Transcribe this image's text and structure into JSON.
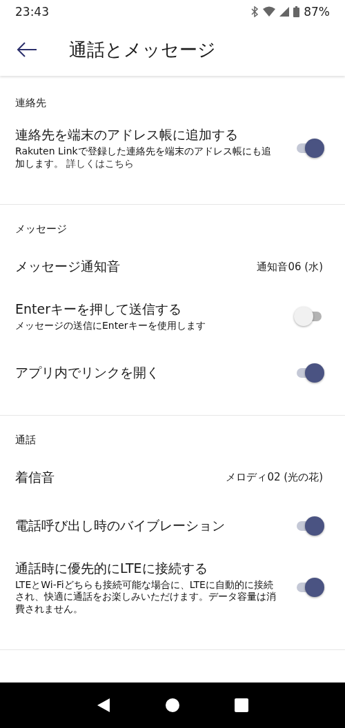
{
  "status_bar": {
    "time": "23:43",
    "battery": "87%"
  },
  "header": {
    "title": "通話とメッセージ"
  },
  "sections": [
    {
      "title": "連絡先",
      "items": [
        {
          "kind": "toggle",
          "label": "連絡先を端末のアドレス帳に追加する",
          "description": "Rakuten Linkで登録した連絡先を端末のアドレス帳にも追加します。",
          "link": "詳しくはこちら",
          "on": true
        }
      ]
    },
    {
      "title": "メッセージ",
      "items": [
        {
          "kind": "value",
          "label": "メッセージ通知音",
          "value": "通知音06 (水)"
        },
        {
          "kind": "toggle",
          "label": "Enterキーを押して送信する",
          "description": "メッセージの送信にEnterキーを使用します",
          "on": false
        },
        {
          "kind": "toggle",
          "label": "アプリ内でリンクを開く",
          "on": true
        }
      ]
    },
    {
      "title": "通話",
      "items": [
        {
          "kind": "value",
          "label": "着信音",
          "value": "メロディ02 (光の花)"
        },
        {
          "kind": "toggle",
          "label": "電話呼び出し時のバイブレーション",
          "on": true
        },
        {
          "kind": "toggle",
          "label": "通話時に優先的にLTEに接続する",
          "description": "LTEとWi-Fiどちらも接続可能な場合に、LTEに自動的に接続され、快適に通話をお楽しみいただけます。データ容量は消費されません。",
          "on": true
        }
      ]
    }
  ]
}
